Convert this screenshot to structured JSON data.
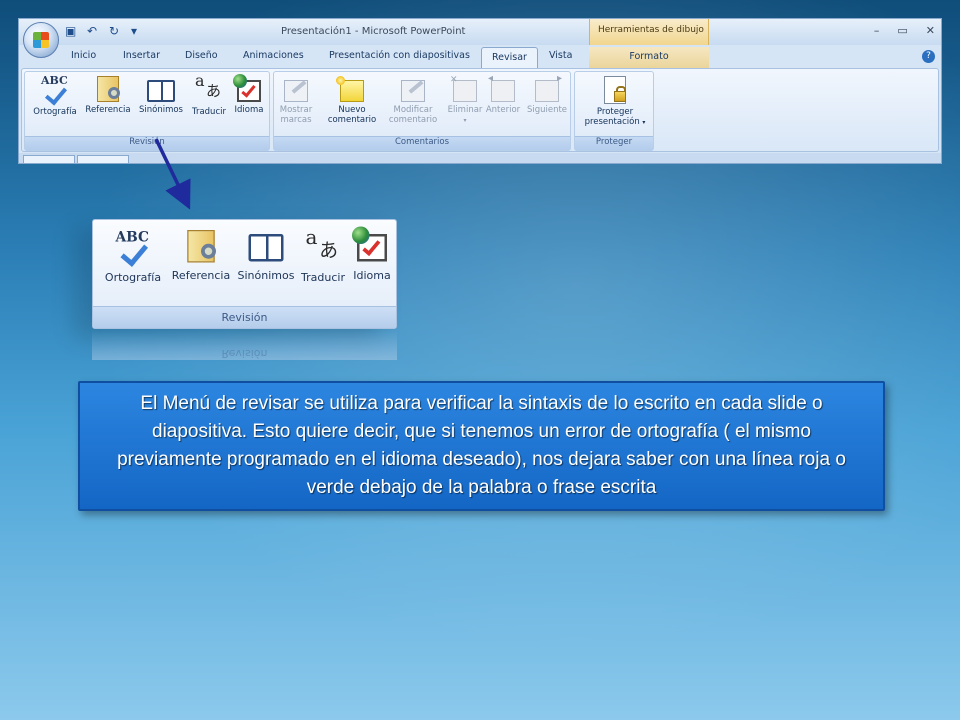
{
  "window": {
    "title": "Presentación1 - Microsoft PowerPoint",
    "context_header": "Herramientas de dibujo",
    "controls": [
      "–",
      "▭",
      "✕"
    ]
  },
  "tabs": [
    "Inicio",
    "Insertar",
    "Diseño",
    "Animaciones",
    "Presentación con diapositivas",
    "Revisar",
    "Vista",
    "Formato"
  ],
  "active_tab": "Revisar",
  "ribbon": {
    "revision": {
      "title": "Revisión",
      "buttons": [
        "Ortografía",
        "Referencia",
        "Sinónimos",
        "Traducir",
        "Idioma"
      ]
    },
    "comentarios": {
      "title": "Comentarios",
      "mostrar": [
        "Mostrar",
        "marcas"
      ],
      "nuevo": [
        "Nuevo",
        "comentario"
      ],
      "modificar": [
        "Modificar",
        "comentario"
      ],
      "eliminar": "Eliminar",
      "anterior": "Anterior",
      "siguiente": "Siguiente"
    },
    "proteger": {
      "title": "Proteger",
      "button": [
        "Proteger",
        "presentación"
      ]
    }
  },
  "zoom": {
    "abc": "ABC",
    "buttons": [
      "Ortografía",
      "Referencia",
      "Sinónimos",
      "Traducir",
      "Idioma"
    ],
    "title": "Revisión",
    "reflection": "Revisión"
  },
  "icons": {
    "abc_text": "ABC",
    "translate_a": "a",
    "translate_j": "あ"
  },
  "caption": "El Menú de revisar se utiliza para verificar la sintaxis de lo escrito en cada slide o diapositiva. Esto quiere decir, que si tenemos un error de ortografía ( el mismo previamente programado en el idioma deseado), nos dejara saber con una línea roja o verde debajo de la palabra o frase escrita",
  "colors": {
    "caption_bg": "#1f77d6",
    "arrow": "#1f2a9c",
    "context_tab": "#f1d68e"
  }
}
